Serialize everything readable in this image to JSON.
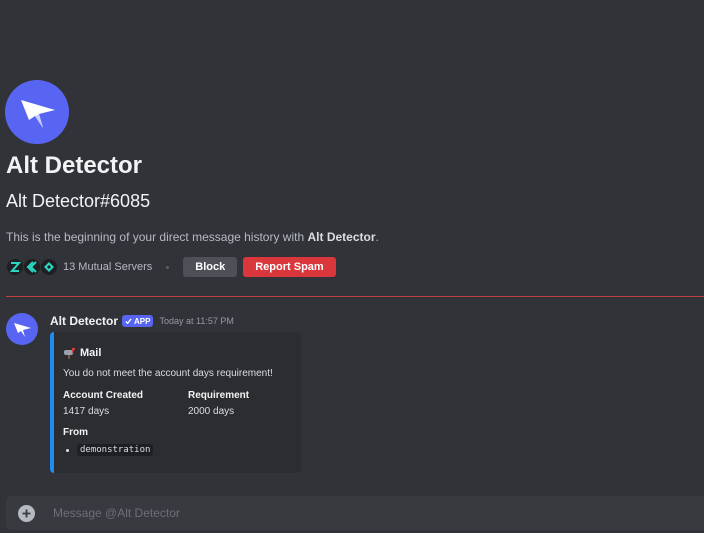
{
  "profile": {
    "name": "Alt Detector",
    "handle": "Alt Detector#6085",
    "intro_prefix": "This is the beginning of your direct message history with ",
    "intro_name": "Alt Detector",
    "intro_suffix": ".",
    "mutual_servers": "13 Mutual Servers",
    "block_label": "Block",
    "report_label": "Report Spam"
  },
  "message": {
    "author": "Alt Detector",
    "badge": "APP",
    "timestamp": "Today at 11:57 PM",
    "embed": {
      "title": "Mail",
      "description": "You do not meet the account days requirement!",
      "fields": [
        {
          "name": "Account Created",
          "value": "1417 days"
        },
        {
          "name": "Requirement",
          "value": "2000 days"
        }
      ],
      "from_label": "From",
      "from_item": "demonstration"
    }
  },
  "composer": {
    "placeholder": "Message @Alt Detector"
  },
  "colors": {
    "background": "#313338",
    "accent": "#5865f2",
    "danger": "#da373c",
    "embed_bar": "#1f8cf0"
  },
  "icons": [
    "bot-avatar-icon",
    "server-icon",
    "verified-check-icon",
    "mailbox-icon",
    "add-attachment-icon"
  ]
}
